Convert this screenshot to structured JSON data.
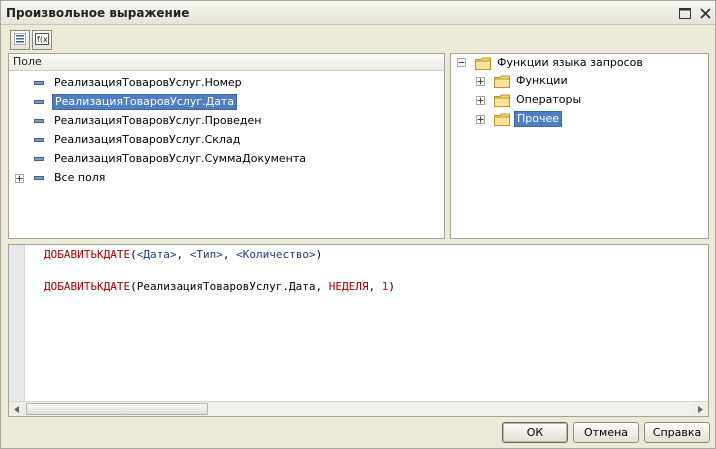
{
  "window": {
    "title": "Произвольное выражение"
  },
  "left_panel": {
    "header": "Поле",
    "items": [
      {
        "label": "РеализацияТоваровУслуг.Номер",
        "selected": false
      },
      {
        "label": "РеализацияТоваровУслуг.Дата",
        "selected": true
      },
      {
        "label": "РеализацияТоваровУслуг.Проведен",
        "selected": false
      },
      {
        "label": "РеализацияТоваровУслуг.Склад",
        "selected": false
      },
      {
        "label": "РеализацияТоваровУслуг.СуммаДокумента",
        "selected": false
      },
      {
        "label": "Все поля",
        "selected": false,
        "expandable": true
      }
    ]
  },
  "right_panel": {
    "root": {
      "label": "Функции языка запросов",
      "expanded": true
    },
    "children": [
      {
        "label": "Функции",
        "selected": false
      },
      {
        "label": "Операторы",
        "selected": false
      },
      {
        "label": "Прочее",
        "selected": true
      }
    ]
  },
  "editor": {
    "line1": {
      "func": "ДОБАВИТЬКДАТЕ",
      "open": "(",
      "p1": "<Дата>",
      "sep1": ", ",
      "p2": "<Тип>",
      "sep2": ", ",
      "p3": "<Количество>",
      "close": ")"
    },
    "line2": {
      "func": "ДОБАВИТЬКДАТЕ",
      "open": "(",
      "arg1": "РеализацияТоваровУслуг.Дата",
      "sep1": ", ",
      "arg2": "НЕДЕЛЯ",
      "sep2": ", ",
      "arg3": "1",
      "close": ")"
    }
  },
  "buttons": {
    "ok": "ОК",
    "cancel": "Отмена",
    "help": "Справка"
  },
  "icons": {
    "toolbar": [
      "list-view-icon",
      "function-icon"
    ],
    "window": [
      "maximize-icon",
      "close-icon"
    ]
  }
}
